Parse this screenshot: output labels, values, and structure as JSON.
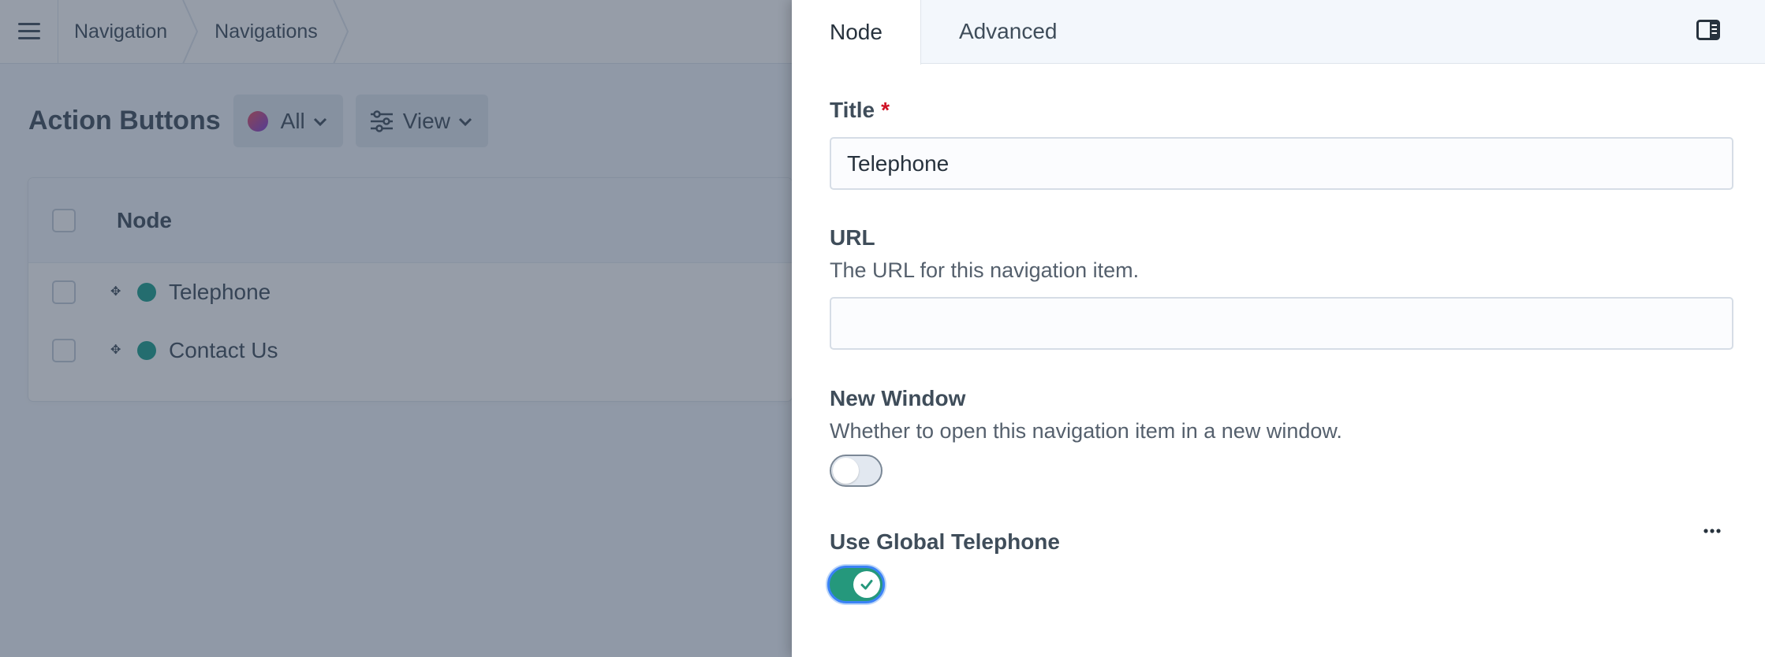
{
  "breadcrumb": [
    "Navigation",
    "Navigations"
  ],
  "page": {
    "title": "Action Buttons",
    "site_filter_label": "All",
    "view_label": "View"
  },
  "table": {
    "column_node": "Node",
    "rows": [
      {
        "title": "Telephone",
        "status": "enabled"
      },
      {
        "title": "Contact Us",
        "status": "enabled"
      }
    ]
  },
  "panel": {
    "tabs": [
      {
        "label": "Node",
        "active": true
      },
      {
        "label": "Advanced",
        "active": false
      }
    ],
    "title_field": {
      "label": "Title",
      "required_mark": "*",
      "value": "Telephone"
    },
    "url_field": {
      "label": "URL",
      "instructions": "The URL for this navigation item.",
      "value": ""
    },
    "new_window_field": {
      "label": "New Window",
      "instructions": "Whether to open this navigation item in a new window.",
      "on": false
    },
    "global_phone_field": {
      "label": "Use Global Telephone",
      "on": true
    }
  },
  "colors": {
    "status_enabled": "#1a9e8c",
    "toggle_on": "#25987c",
    "required": "#cf1124",
    "focus_ring": "#3b82f6"
  },
  "icons": [
    "hamburger-icon",
    "chevron-down-icon",
    "sliders-icon",
    "drag-handle-icon",
    "sidebar-toggle-icon",
    "ellipsis-icon",
    "check-icon"
  ]
}
